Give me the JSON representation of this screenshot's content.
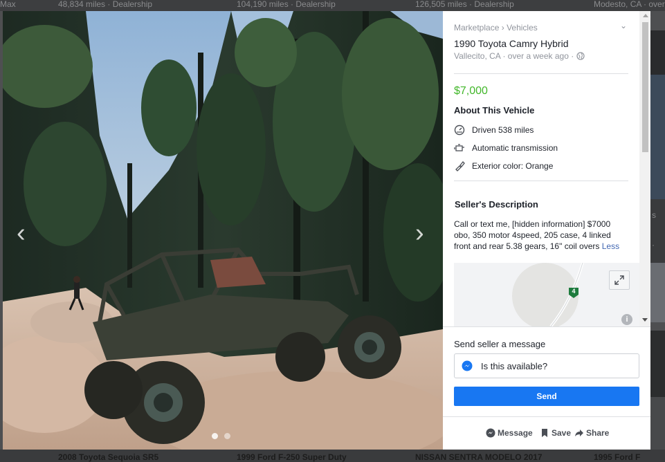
{
  "background": {
    "top_items": [
      {
        "text": "Max"
      },
      {
        "text": "48,834 miles · Dealership"
      },
      {
        "text": "104,190 miles · Dealership"
      },
      {
        "text": "126,505 miles · Dealership"
      },
      {
        "text": "Modesto, CA · over"
      }
    ],
    "bottom_items": [
      {
        "text": "2008 Toyota Sequoia SR5"
      },
      {
        "text": "1999 Ford F-250 Super Duty"
      },
      {
        "text": "NISSAN SENTRA MODELO 2017"
      },
      {
        "text": "1995 Ford F"
      }
    ],
    "side_letters": [
      "s",
      "·"
    ]
  },
  "listing": {
    "breadcrumb": {
      "marketplace": "Marketplace",
      "sep": "›",
      "category": "Vehicles"
    },
    "title": "1990 Toyota Camry Hybrid",
    "location_time": "Vallecito, CA · over a week ago ·",
    "price": "$7,000",
    "about_heading": "About This Vehicle",
    "features": [
      {
        "icon": "speedometer-icon",
        "text": "Driven 538 miles"
      },
      {
        "icon": "engine-icon",
        "text": "Automatic transmission"
      },
      {
        "icon": "paint-brush-icon",
        "text": "Exterior color: Orange"
      }
    ],
    "seller_heading": "Seller's Description",
    "description": "Call or text me, [hidden information] $7000 obo, 350 motor 4speed, 205 case, 4 linked front and rear 5.38 gears, 16\" coil overs ",
    "less_link": "Less",
    "map_route_label": "4"
  },
  "message": {
    "label": "Send seller a message",
    "input_value": "Is this available?",
    "send_label": "Send"
  },
  "actions": {
    "message": "Message",
    "save": "Save",
    "share": "Share"
  },
  "photo": {
    "index": 0,
    "count": 2
  }
}
